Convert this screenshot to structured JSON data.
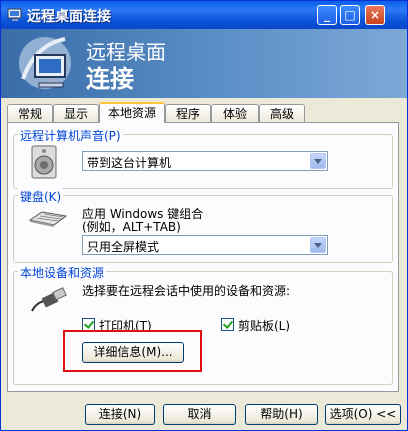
{
  "window": {
    "title": "远程桌面连接",
    "min": "_",
    "max": "□",
    "close": "×"
  },
  "banner": {
    "line1": "远程桌面",
    "line2": "连接"
  },
  "tabs": [
    "常规",
    "显示",
    "本地资源",
    "程序",
    "体验",
    "高级"
  ],
  "active_tab": "本地资源",
  "sound": {
    "group_label": "远程计算机声音(P)",
    "value": "带到这台计算机"
  },
  "keyboard": {
    "group_label": "键盘(K)",
    "line1": "应用 Windows 键组合",
    "line2": "(例如，ALT+TAB)",
    "value": "只用全屏模式"
  },
  "devices": {
    "group_label": "本地设备和资源",
    "desc": "选择要在远程会话中使用的设备和资源:",
    "printer": "打印机(T)",
    "clipboard": "剪贴板(L)",
    "details_button": "详细信息(M)..."
  },
  "footer": {
    "connect": "连接(N)",
    "cancel": "取消",
    "help": "帮助(H)",
    "options": "选项(O) <<"
  },
  "colors": {
    "titlebar": "#0a5ee8",
    "group_label": "#0046d5",
    "highlight": "#e01010"
  }
}
